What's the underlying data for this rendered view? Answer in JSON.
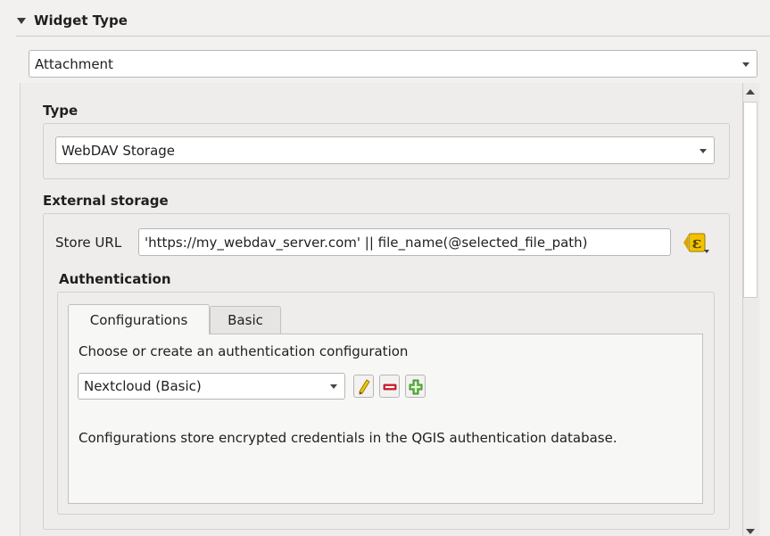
{
  "section": {
    "title": "Widget Type"
  },
  "widget_type": {
    "selected": "Attachment"
  },
  "type_group": {
    "title": "Type",
    "selected": "WebDAV Storage"
  },
  "external_storage": {
    "title": "External storage",
    "store_url_label": "Store URL",
    "store_url_value": "'https://my_webdav_server.com' || file_name(@selected_file_path)",
    "expression_icon": "epsilon-expression-icon"
  },
  "authentication": {
    "title": "Authentication",
    "tabs": [
      {
        "label": "Configurations",
        "active": true
      },
      {
        "label": "Basic",
        "active": false
      }
    ],
    "prompt": "Choose or create an authentication configuration",
    "selected_config": "Nextcloud (Basic)",
    "buttons": [
      {
        "icon": "pencil-edit-icon"
      },
      {
        "icon": "remove-minus-icon"
      },
      {
        "icon": "add-plus-icon"
      }
    ],
    "info": "Configurations store encrypted credentials in the QGIS authentication database."
  }
}
